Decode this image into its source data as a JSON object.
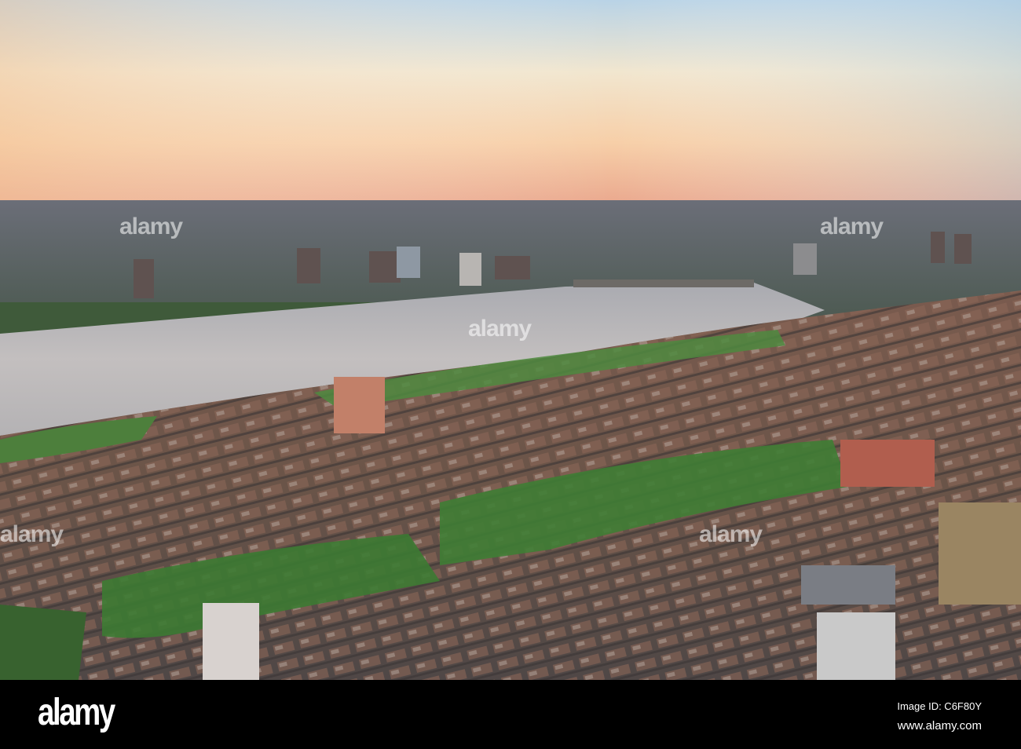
{
  "photo": {
    "subject": "Aerial view of city and river at sunset"
  },
  "watermark": {
    "text": "alamy"
  },
  "footer": {
    "logo": "alamy",
    "image_id": "Image ID: C6F80Y",
    "website": "www.alamy.com"
  }
}
